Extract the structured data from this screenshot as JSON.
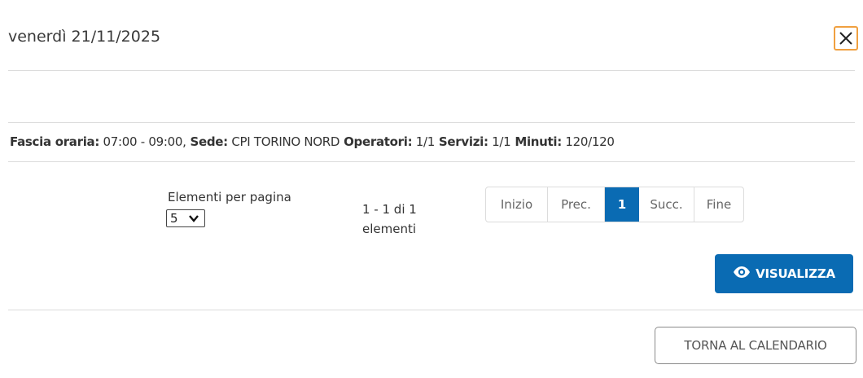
{
  "modal": {
    "title": "venerdì 21/11/2025",
    "close_icon": "close-icon"
  },
  "info": {
    "fascia_label": "Fascia oraria:",
    "fascia_value": " 07:00 - 09:00,",
    "sede_label": " Sede:",
    "sede_value": " CPI TORINO NORD",
    "operatori_label": " Operatori:",
    "operatori_value": " 1/1",
    "servizi_label": " Servizi:",
    "servizi_value": " 1/1",
    "minuti_label": " Minuti:",
    "minuti_value": " 120/120"
  },
  "pagination": {
    "per_page_label": "Elementi per pagina",
    "per_page_value": "5",
    "count_line1": "1 - 1 di 1",
    "count_line2": "elementi",
    "buttons": {
      "first": "Inizio",
      "prev": "Prec.",
      "current": "1",
      "next": "Succ.",
      "last": "Fine"
    }
  },
  "actions": {
    "view_label": "VISUALIZZA",
    "view_icon": "eye-icon",
    "back_label": "TORNA AL CALENDARIO"
  },
  "colors": {
    "primary": "#0a6bb3",
    "close_focus": "#f0a040"
  }
}
